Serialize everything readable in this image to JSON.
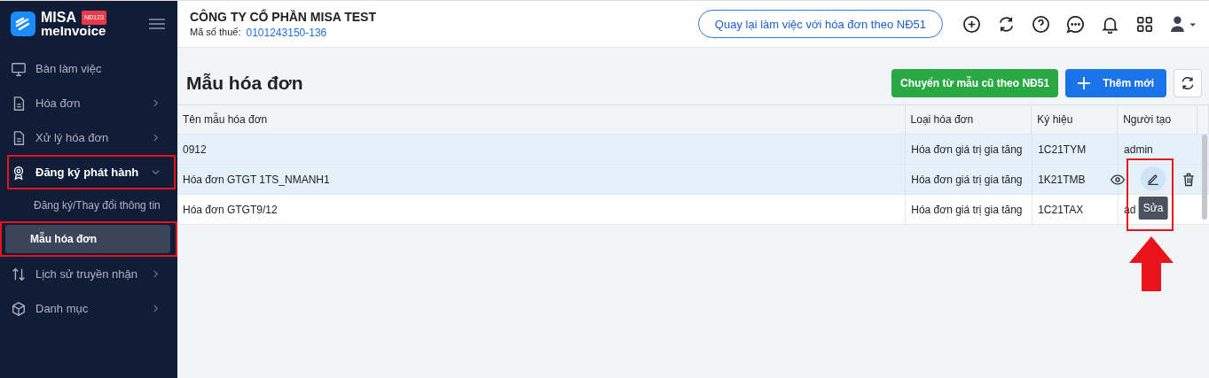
{
  "brand": {
    "name": "MISA",
    "product": "meInvoice",
    "badge": "NĐ123"
  },
  "company": {
    "name": "CÔNG TY CỔ PHẦN MISA TEST",
    "tax_label": "Mã số thuế:",
    "tax_code": "0101243150-136"
  },
  "back_button": "Quay lại làm việc với hóa đơn theo NĐ51",
  "sidebar": {
    "items": [
      {
        "label": "Bàn làm việc",
        "expandable": false,
        "expanded": false,
        "annotated": false
      },
      {
        "label": "Hóa đơn",
        "expandable": true,
        "expanded": false,
        "annotated": false
      },
      {
        "label": "Xử lý hóa đơn",
        "expandable": true,
        "expanded": false,
        "annotated": false
      },
      {
        "label": "Đăng ký phát hành",
        "expandable": true,
        "expanded": true,
        "annotated": true,
        "children": [
          {
            "label": "Đăng ký/Thay đổi thông tin",
            "selected": false,
            "annotated": false
          },
          {
            "label": "Mẫu hóa đơn",
            "selected": true,
            "annotated": true
          }
        ]
      },
      {
        "label": "Lịch sử truyền nhận",
        "expandable": true,
        "expanded": false,
        "annotated": false
      },
      {
        "label": "Danh mục",
        "expandable": true,
        "expanded": false,
        "annotated": false
      }
    ]
  },
  "page_title": "Mẫu hóa đơn",
  "convert_button": "Chuyển từ mẫu cũ theo NĐ51",
  "add_button": "Thêm mới",
  "table": {
    "columns": [
      "Tên mẫu hóa đơn",
      "Loại hóa đơn",
      "Ký hiệu",
      "Người tạo"
    ],
    "rows": [
      {
        "cells": [
          "0912",
          "Hóa đơn giá trị gia tăng",
          "1C21TYM",
          "admin"
        ],
        "highlighted": true,
        "show_actions": false
      },
      {
        "cells": [
          "Hóa đơn GTGT 1TS_NMANH1",
          "Hóa đơn giá trị gia tăng",
          "1K21TMB",
          ""
        ],
        "highlighted": true,
        "show_actions": true
      },
      {
        "cells": [
          "Hóa đơn GTGT9/12",
          "Hóa đơn giá trị gia tăng",
          "1C21TAX",
          "ad"
        ],
        "highlighted": false,
        "show_actions": false
      }
    ]
  },
  "edit_action": {
    "annotated": true,
    "tooltip": "Sửa"
  }
}
